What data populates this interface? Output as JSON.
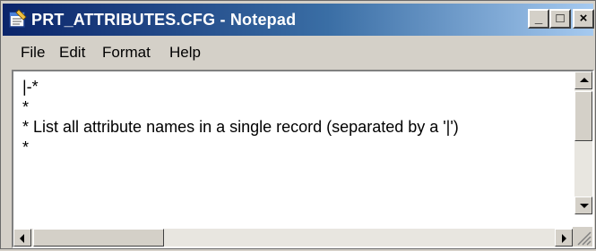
{
  "window": {
    "title": "PRT_ATTRIBUTES.CFG - Notepad",
    "icon": "notepad-icon",
    "controls": {
      "minimize": "_",
      "maximize": "□",
      "close": "×"
    }
  },
  "menu": {
    "items": [
      {
        "label": "File"
      },
      {
        "label": "Edit"
      },
      {
        "label": "Format"
      },
      {
        "label": "Help"
      }
    ]
  },
  "editor": {
    "lines": [
      "|-*",
      "*",
      "* List all attribute names in a single record (separated by a '|')",
      "*"
    ]
  },
  "colors": {
    "titlebar_start": "#0a246a",
    "titlebar_end": "#a6caf0",
    "chrome": "#d4d0c8"
  }
}
